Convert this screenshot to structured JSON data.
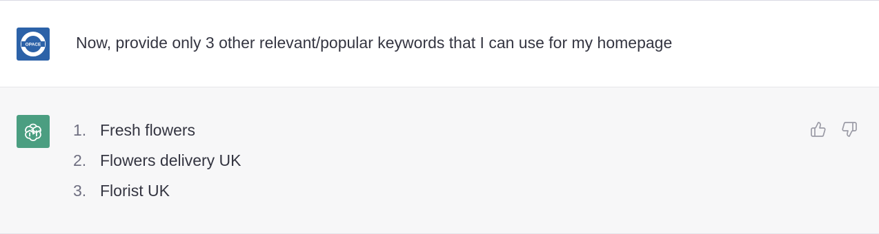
{
  "conversation": {
    "user_message": {
      "avatar_label": "OPACE",
      "text": "Now, provide only 3 other relevant/popular keywords that I can use for my homepage"
    },
    "assistant_message": {
      "items": [
        {
          "number": "1.",
          "text": "Fresh flowers"
        },
        {
          "number": "2.",
          "text": "Flowers delivery UK"
        },
        {
          "number": "3.",
          "text": "Florist UK"
        }
      ],
      "feedback": {
        "like_icon": "thumbs-up-icon",
        "dislike_icon": "thumbs-down-icon"
      }
    }
  },
  "colors": {
    "user_avatar_bg": "#2c62a8",
    "assistant_avatar_bg": "#4b9e81",
    "assistant_row_bg": "#f7f7f8",
    "text": "#343541"
  }
}
